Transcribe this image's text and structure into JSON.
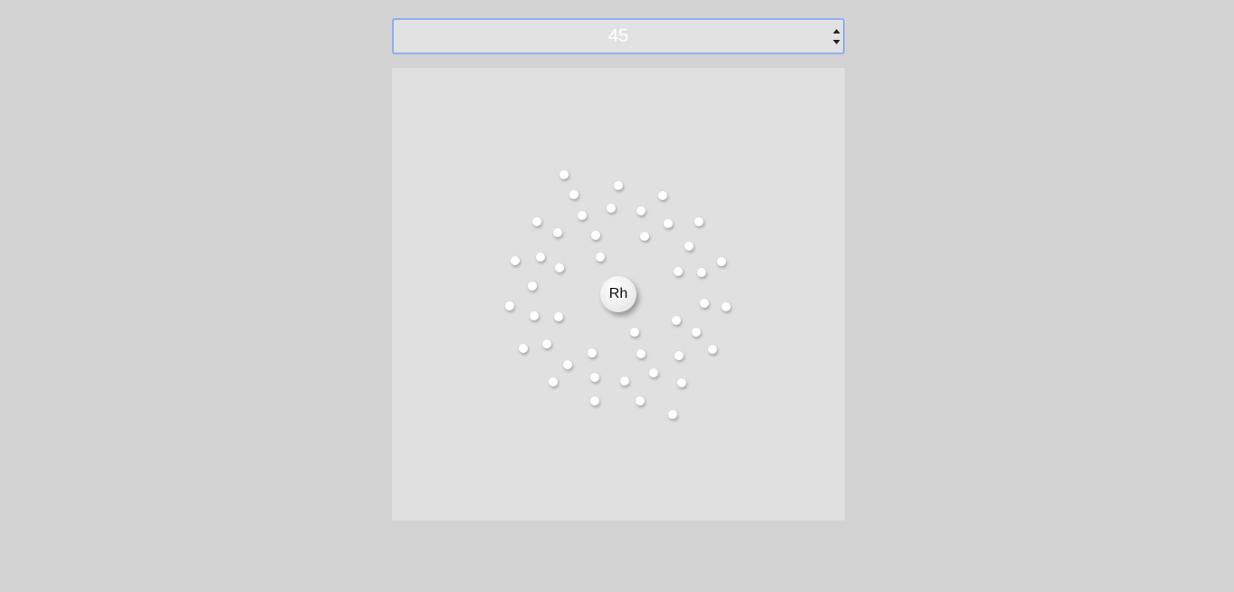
{
  "atomic_number_input": {
    "value": "45"
  },
  "atom": {
    "symbol": "Rh",
    "electron_count": 45
  },
  "colors": {
    "background": "#d3d3d3",
    "stage": "#e0e0e0",
    "input_border": "#8fb0f0",
    "input_text": "#ffffff"
  }
}
